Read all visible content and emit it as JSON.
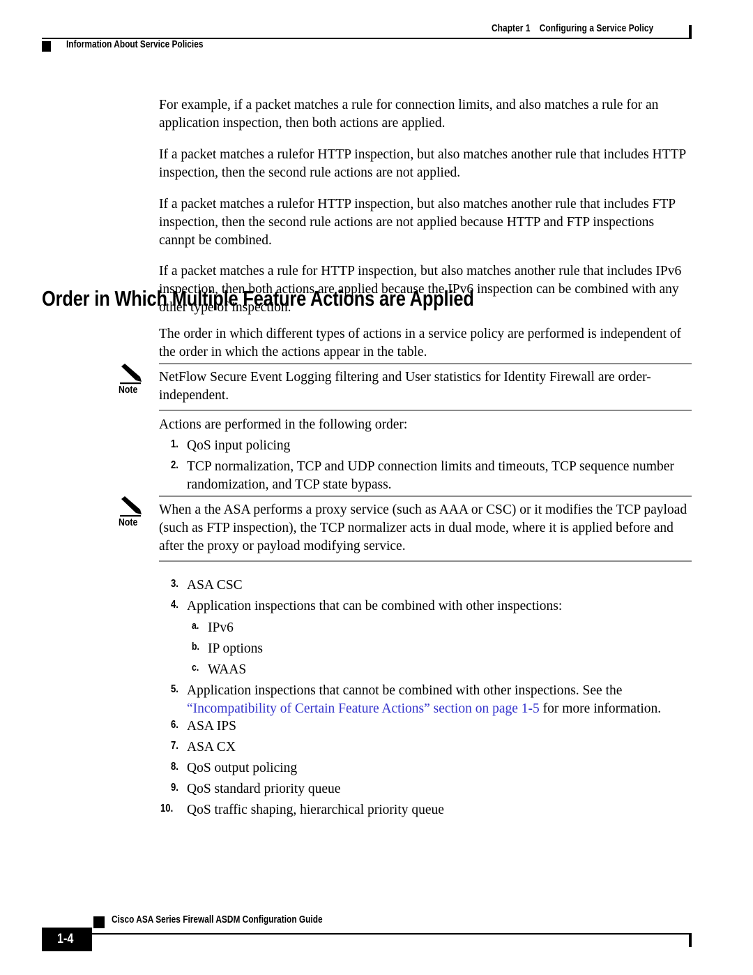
{
  "header": {
    "chapter_label": "Chapter 1",
    "chapter_title": "Configuring a Service Policy",
    "running_head": "Information About Service Policies"
  },
  "intro_paragraphs": [
    "For example, if a packet matches a rule for connection limits, and also matches a rule for an application inspection, then both actions are applied.",
    "If a packet matches a rulefor HTTP inspection, but also matches another rule that includes HTTP inspection, then the second rule actions are not applied.",
    "If a packet matches a rulefor HTTP inspection, but also matches another rule that includes FTP inspection, then the second rule actions are not applied because HTTP and FTP inspections cannpt be combined.",
    "If a packet matches a rule for HTTP inspection, but also matches another rule that includes IPv6 inspection, then both actions are applied because the IPv6 inspection can be combined with any other type of inspection."
  ],
  "section": {
    "heading": "Order in Which Multiple Feature Actions are Applied",
    "lead_paragraph": "The order in which different types of actions in a service policy are performed is independent of the order in which the actions appear in the table.",
    "order_intro": "Actions are performed in the following order:"
  },
  "note_one": {
    "label": "Note",
    "text": "NetFlow Secure Event Logging filtering and User statistics for Identity Firewall are order-independent."
  },
  "note_two": {
    "label": "Note",
    "text": "When a the ASA performs a proxy service (such as AAA or CSC) or it modifies the TCP payload (such as FTP inspection), the TCP normalizer acts in dual mode, where it is applied before and after the proxy or payload modifying service."
  },
  "steps": {
    "one": {
      "num": "1.",
      "text": "QoS input policing"
    },
    "two": {
      "num": "2.",
      "text": "TCP normalization, TCP and UDP connection limits and timeouts, TCP sequence number randomization, and TCP state bypass."
    },
    "three": {
      "num": "3.",
      "text": "ASA CSC"
    },
    "four": {
      "num": "4.",
      "text": "Application inspections that can be combined with other inspections:"
    },
    "four_a": {
      "num": "a.",
      "text": "IPv6"
    },
    "four_b": {
      "num": "b.",
      "text": "IP options"
    },
    "four_c": {
      "num": "c.",
      "text": "WAAS"
    },
    "five": {
      "num": "5.",
      "text_before": "Application inspections that cannot be combined with other inspections. See the ",
      "link_text": "“Incompatibility of Certain Feature Actions” section on page 1-5",
      "text_after": " for more information."
    },
    "six": {
      "num": "6.",
      "text": "ASA IPS"
    },
    "seven": {
      "num": "7.",
      "text": "ASA CX"
    },
    "eight": {
      "num": "8.",
      "text": "QoS output policing"
    },
    "nine": {
      "num": "9.",
      "text": "QoS standard priority queue"
    },
    "ten": {
      "num": "10.",
      "text": "QoS traffic shaping, hierarchical priority queue"
    }
  },
  "footer": {
    "page_number": "1-4",
    "guide_title": "Cisco ASA Series Firewall ASDM Configuration Guide"
  },
  "colors": {
    "link": "#3333cc",
    "rule": "#8c8c8c",
    "text": "#000000"
  }
}
